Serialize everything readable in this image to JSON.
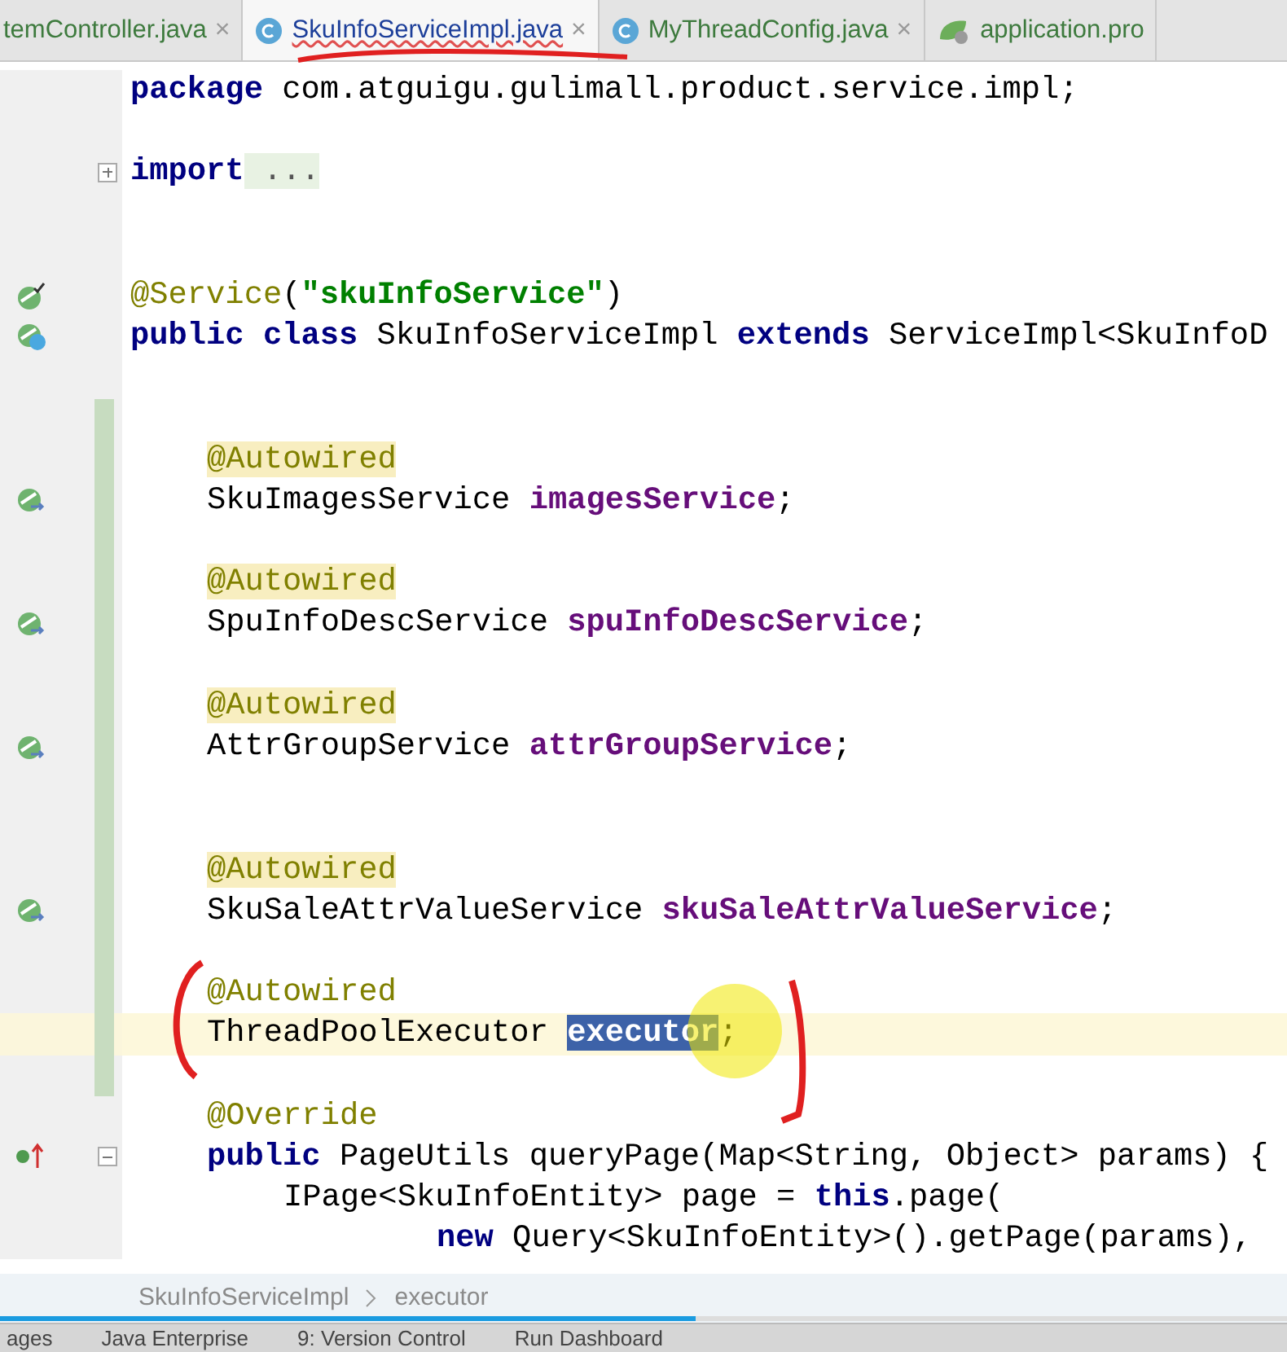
{
  "tabs": [
    {
      "label": "temController.java",
      "selected": false,
      "close": "×"
    },
    {
      "label": "SkuInfoServiceImpl.java",
      "kind": "class",
      "selected": true,
      "close": "×"
    },
    {
      "label": "MyThreadConfig.java",
      "kind": "class",
      "selected": false,
      "close": "×"
    },
    {
      "label": "application.pro",
      "kind": "config",
      "selected": false
    }
  ],
  "lines": [
    {
      "kind": "top",
      "changed": false,
      "current": false,
      "tokens": [
        {
          "t": "package",
          "kind": "keyword"
        },
        {
          "t": " com.atguigu.gulimall.product.service.impl;",
          "kind": "plain"
        }
      ]
    },
    {
      "kind": "blank",
      "changed": false,
      "current": false
    },
    {
      "kind": "top",
      "changed": false,
      "current": false,
      "fold": {
        "kind": "collapsed"
      },
      "tokens": [
        {
          "t": "import",
          "kind": "keyword"
        },
        {
          "t": " ...",
          "kind": "folded"
        }
      ]
    },
    {
      "kind": "blank",
      "changed": false,
      "current": false
    },
    {
      "kind": "blank",
      "changed": false,
      "current": false
    },
    {
      "kind": "top",
      "changed": false,
      "current": false,
      "gutter": {
        "kind": "bean"
      },
      "tokens": [
        {
          "t": "@Service",
          "kind": "annotation"
        },
        {
          "t": "(",
          "kind": "plain"
        },
        {
          "t": "\"skuInfoService\"",
          "kind": "string"
        },
        {
          "t": ")",
          "kind": "plain"
        }
      ]
    },
    {
      "kind": "top",
      "changed": false,
      "current": false,
      "gutter": {
        "kind": "class-bean"
      },
      "tokens": [
        {
          "t": "public class",
          "kind": "keyword"
        },
        {
          "t": " SkuInfoServiceImpl ",
          "kind": "plain"
        },
        {
          "t": "extends",
          "kind": "keyword"
        },
        {
          "t": " ServiceImpl<SkuInfoD",
          "kind": "plain"
        }
      ]
    },
    {
      "kind": "blank",
      "changed": false,
      "current": false
    },
    {
      "kind": "blank",
      "changed": true,
      "current": false
    },
    {
      "kind": "member",
      "changed": true,
      "current": false,
      "tokens": [
        {
          "t": "@Autowired",
          "kind": "annotation-usage"
        }
      ]
    },
    {
      "kind": "member",
      "changed": true,
      "current": false,
      "gutter": {
        "kind": "autowire"
      },
      "tokens": [
        {
          "t": "SkuImagesService ",
          "kind": "plain"
        },
        {
          "t": "imagesService",
          "kind": "field"
        },
        {
          "t": ";",
          "kind": "plain"
        }
      ]
    },
    {
      "kind": "blank",
      "changed": true,
      "current": false
    },
    {
      "kind": "member",
      "changed": true,
      "current": false,
      "tokens": [
        {
          "t": "@Autowired",
          "kind": "annotation-usage"
        }
      ]
    },
    {
      "kind": "member",
      "changed": true,
      "current": false,
      "gutter": {
        "kind": "autowire"
      },
      "tokens": [
        {
          "t": "SpuInfoDescService ",
          "kind": "plain"
        },
        {
          "t": "spuInfoDescService",
          "kind": "field"
        },
        {
          "t": ";",
          "kind": "plain"
        }
      ]
    },
    {
      "kind": "blank",
      "changed": true,
      "current": false
    },
    {
      "kind": "member",
      "changed": true,
      "current": false,
      "tokens": [
        {
          "t": "@Autowired",
          "kind": "annotation-usage"
        }
      ]
    },
    {
      "kind": "member",
      "changed": true,
      "current": false,
      "gutter": {
        "kind": "autowire"
      },
      "tokens": [
        {
          "t": "AttrGroupService ",
          "kind": "plain"
        },
        {
          "t": "attrGroupService",
          "kind": "field"
        },
        {
          "t": ";",
          "kind": "plain"
        }
      ]
    },
    {
      "kind": "blank",
      "changed": true,
      "current": false
    },
    {
      "kind": "blank",
      "changed": true,
      "current": false
    },
    {
      "kind": "member",
      "changed": true,
      "current": false,
      "tokens": [
        {
          "t": "@Autowired",
          "kind": "annotation-usage"
        }
      ]
    },
    {
      "kind": "member",
      "changed": true,
      "current": false,
      "gutter": {
        "kind": "autowire"
      },
      "tokens": [
        {
          "t": "SkuSaleAttrValueService ",
          "kind": "plain"
        },
        {
          "t": "skuSaleAttrValueService",
          "kind": "field"
        },
        {
          "t": ";",
          "kind": "plain"
        }
      ]
    },
    {
      "kind": "blank",
      "changed": true,
      "current": false
    },
    {
      "kind": "member",
      "changed": true,
      "current": false,
      "tokens": [
        {
          "t": "@Autowired",
          "kind": "annotation"
        }
      ]
    },
    {
      "kind": "member",
      "changed": true,
      "current": true,
      "tokens": [
        {
          "t": "ThreadPoolExecutor ",
          "kind": "plain"
        },
        {
          "t": "executor",
          "kind": "selected"
        },
        {
          "t": ";",
          "kind": "plain"
        }
      ]
    },
    {
      "kind": "blank",
      "changed": true,
      "current": false
    },
    {
      "kind": "member",
      "changed": false,
      "current": false,
      "tokens": [
        {
          "t": "@Override",
          "kind": "annotation"
        }
      ]
    },
    {
      "kind": "member",
      "changed": false,
      "current": false,
      "gutter": {
        "kind": "override"
      },
      "fold": {
        "kind": "open"
      },
      "tokens": [
        {
          "t": "public",
          "kind": "keyword"
        },
        {
          "t": " PageUtils queryPage(Map<String, Object> params) {",
          "kind": "plain"
        }
      ]
    },
    {
      "kind": "body",
      "changed": false,
      "current": false,
      "tokens": [
        {
          "t": "IPage<SkuInfoEntity> page = ",
          "kind": "plain"
        },
        {
          "t": "this",
          "kind": "keyword"
        },
        {
          "t": ".page(",
          "kind": "plain"
        }
      ]
    },
    {
      "kind": "continuation",
      "changed": false,
      "current": false,
      "tokens": [
        {
          "t": "new",
          "kind": "keyword"
        },
        {
          "t": " Query<SkuInfoEntity>().getPage(params),",
          "kind": "plain"
        }
      ]
    }
  ],
  "breadcrumb": [
    "SkuInfoServiceImpl",
    "executor"
  ],
  "video_progress": {
    "level": 0.54
  },
  "tool_tabs": [
    "ages",
    "Java Enterprise",
    "9: Version Control",
    "Run Dashboard"
  ]
}
